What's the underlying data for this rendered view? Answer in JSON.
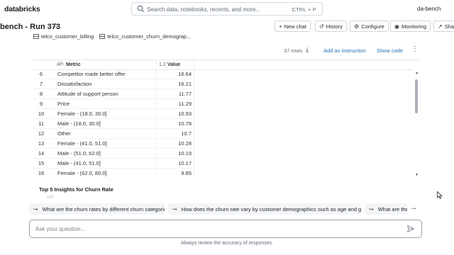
{
  "app": {
    "logo": "databricks",
    "user": "da-bench"
  },
  "search": {
    "placeholder": "Search data, notebooks, recents, and more...",
    "shortcut": "CTRL + P"
  },
  "header": {
    "title": "bench - Run 373",
    "buttons": [
      {
        "label": "New chat",
        "icon": "plus-icon",
        "glyph": "+"
      },
      {
        "label": "History",
        "icon": "history-icon",
        "glyph": "↺"
      },
      {
        "label": "Configure",
        "icon": "gear-icon",
        "glyph": "⚙"
      },
      {
        "label": "Monitoring",
        "icon": "eye-icon",
        "glyph": "◉"
      },
      {
        "label": "Sha",
        "icon": "share-icon",
        "glyph": "↗"
      }
    ]
  },
  "tables": [
    "telco_customer_billing",
    "telco_customer_churn_demograp..."
  ],
  "results": {
    "row_count": "37 rows",
    "add_instruction": "Add as instruction",
    "show_code": "Show code",
    "columns": {
      "metric": "Metric",
      "value": "Value",
      "metric_type": "Aᴮᶜ",
      "value_type": "1.2"
    },
    "rows": [
      {
        "idx": "6",
        "metric": "Competitor made better offer",
        "value": "16.64"
      },
      {
        "idx": "7",
        "metric": "Dissatisfaction",
        "value": "16.21"
      },
      {
        "idx": "8",
        "metric": "Attitude of support person",
        "value": "11.77"
      },
      {
        "idx": "9",
        "metric": "Price",
        "value": "11.29"
      },
      {
        "idx": "10",
        "metric": "Female - (18.0, 30.0]",
        "value": "10.93"
      },
      {
        "idx": "11",
        "metric": "Male - (18.0, 30.0]",
        "value": "10.78"
      },
      {
        "idx": "12",
        "metric": "Other",
        "value": "10.7"
      },
      {
        "idx": "13",
        "metric": "Female - (41.0, 51.0]",
        "value": "10.28"
      },
      {
        "idx": "14",
        "metric": "Male - (51.0, 62.0]",
        "value": "10.19"
      },
      {
        "idx": "15",
        "metric": "Male - (41.0, 51.0]",
        "value": "10.17"
      },
      {
        "idx": "16",
        "metric": "Female - (62.0, 80.0]",
        "value": "9.85"
      }
    ]
  },
  "insights_title": "Top 5 Insights for Churn Rate",
  "insights_faint": "100",
  "suggestions": [
    "What are the churn rates by different churn categories?",
    "How does the churn rate vary by customer demographics such as age and gender?",
    "What are the"
  ],
  "ask": {
    "placeholder": "Ask your question..."
  },
  "footer": "Always review the accuracy of responses."
}
